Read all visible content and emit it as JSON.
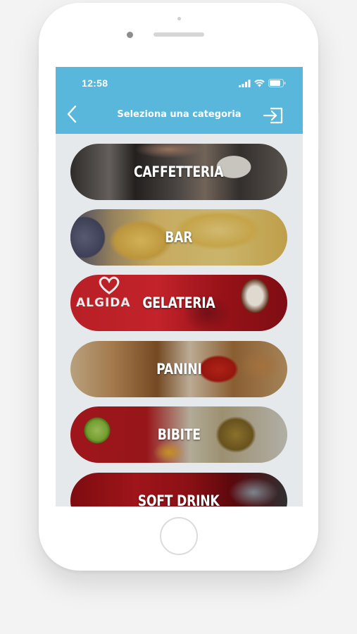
{
  "status_bar": {
    "time": "12:58"
  },
  "header": {
    "title": "Seleziona una categoria",
    "accent_color": "#58b7db",
    "back_icon": "chevron-left-icon",
    "logout_icon": "logout-icon"
  },
  "categories": [
    {
      "label": "CAFFETTERIA"
    },
    {
      "label": "BAR"
    },
    {
      "label": "GELATERIA",
      "logo_text": "ALGIDA"
    },
    {
      "label": "PANINI"
    },
    {
      "label": "BIBITE"
    },
    {
      "label": "SOFT DRINK"
    }
  ]
}
